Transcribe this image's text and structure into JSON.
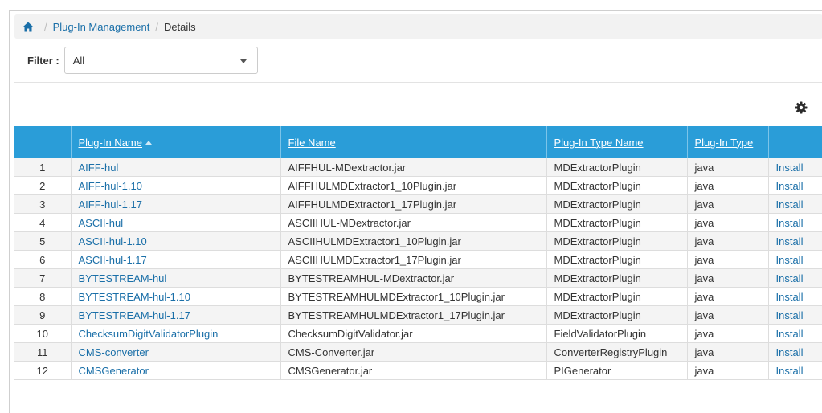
{
  "breadcrumb": {
    "home_icon": "home-icon",
    "items": [
      "Plug-In Management",
      "Details"
    ]
  },
  "filter": {
    "label": "Filter :",
    "value": "All"
  },
  "toolbar": {
    "settings_icon": "gear-icon"
  },
  "table": {
    "columns": [
      "",
      "Plug-In Name",
      "File Name",
      "Plug-In Type Name",
      "Plug-In Type",
      ""
    ],
    "sort_column": "Plug-In Name",
    "rows": [
      {
        "num": "1",
        "name": "AIFF-hul",
        "file": "AIFFHUL-MDextractor.jar",
        "type_name": "MDExtractorPlugin",
        "type": "java",
        "action": "Install"
      },
      {
        "num": "2",
        "name": "AIFF-hul-1.10",
        "file": "AIFFHULMDExtractor1_10Plugin.jar",
        "type_name": "MDExtractorPlugin",
        "type": "java",
        "action": "Install"
      },
      {
        "num": "3",
        "name": "AIFF-hul-1.17",
        "file": "AIFFHULMDExtractor1_17Plugin.jar",
        "type_name": "MDExtractorPlugin",
        "type": "java",
        "action": "Install"
      },
      {
        "num": "4",
        "name": "ASCII-hul",
        "file": "ASCIIHUL-MDextractor.jar",
        "type_name": "MDExtractorPlugin",
        "type": "java",
        "action": "Install"
      },
      {
        "num": "5",
        "name": "ASCII-hul-1.10",
        "file": "ASCIIHULMDExtractor1_10Plugin.jar",
        "type_name": "MDExtractorPlugin",
        "type": "java",
        "action": "Install"
      },
      {
        "num": "6",
        "name": "ASCII-hul-1.17",
        "file": "ASCIIHULMDExtractor1_17Plugin.jar",
        "type_name": "MDExtractorPlugin",
        "type": "java",
        "action": "Install"
      },
      {
        "num": "7",
        "name": "BYTESTREAM-hul",
        "file": "BYTESTREAMHUL-MDextractor.jar",
        "type_name": "MDExtractorPlugin",
        "type": "java",
        "action": "Install"
      },
      {
        "num": "8",
        "name": "BYTESTREAM-hul-1.10",
        "file": "BYTESTREAMHULMDExtractor1_10Plugin.jar",
        "type_name": "MDExtractorPlugin",
        "type": "java",
        "action": "Install"
      },
      {
        "num": "9",
        "name": "BYTESTREAM-hul-1.17",
        "file": "BYTESTREAMHULMDExtractor1_17Plugin.jar",
        "type_name": "MDExtractorPlugin",
        "type": "java",
        "action": "Install"
      },
      {
        "num": "10",
        "name": "ChecksumDigitValidatorPlugin",
        "file": "ChecksumDigitValidator.jar",
        "type_name": "FieldValidatorPlugin",
        "type": "java",
        "action": "Install"
      },
      {
        "num": "11",
        "name": "CMS-converter",
        "file": "CMS-Converter.jar",
        "type_name": "ConverterRegistryPlugin",
        "type": "java",
        "action": "Install"
      },
      {
        "num": "12",
        "name": "CMSGenerator",
        "file": "CMSGenerator.jar",
        "type_name": "PIGenerator",
        "type": "java",
        "action": "Install"
      }
    ]
  },
  "colors": {
    "header_bg": "#2a9dd8",
    "link": "#1a6fa8",
    "row_alt": "#f4f4f4"
  }
}
